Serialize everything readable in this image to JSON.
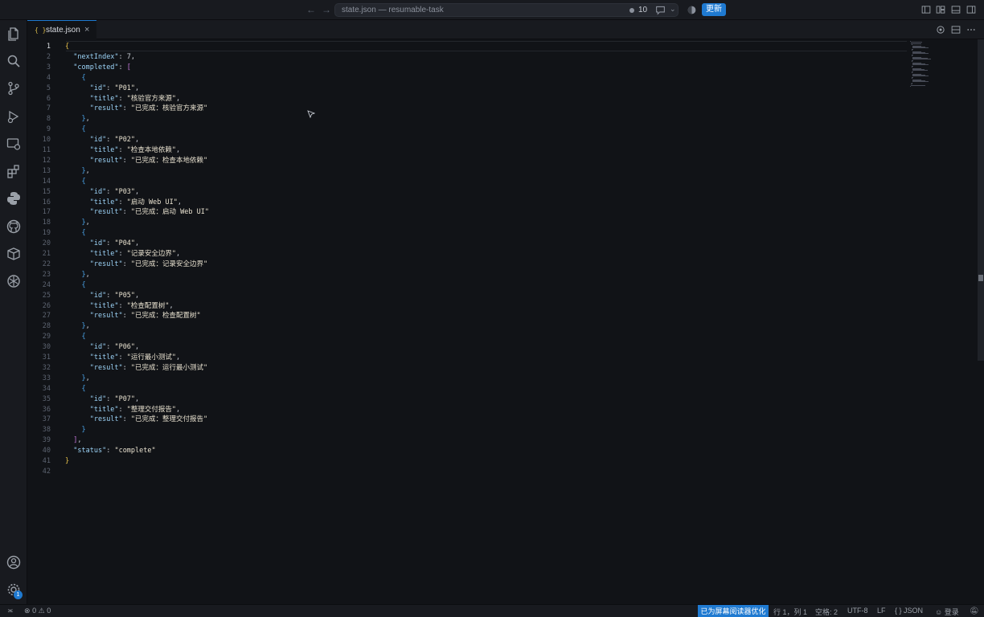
{
  "titlebar": {
    "back_icon": "arrow-left-icon",
    "forward_icon": "arrow-right-icon",
    "title": "state.json — resumable-task",
    "notification_count": "10",
    "update_label": "更新"
  },
  "tab": {
    "icon_glyph": "{ }",
    "label": "state.json",
    "close_glyph": "×"
  },
  "editor": {
    "active_line": 1,
    "lines": [
      "{",
      "  \"nextIndex\": 7,",
      "  \"completed\": [",
      "    {",
      "      \"id\": \"P01\",",
      "      \"title\": \"核验官方来源\",",
      "      \"result\": \"已完成：核验官方来源\"",
      "    },",
      "    {",
      "      \"id\": \"P02\",",
      "      \"title\": \"检查本地依赖\",",
      "      \"result\": \"已完成：检查本地依赖\"",
      "    },",
      "    {",
      "      \"id\": \"P03\",",
      "      \"title\": \"启动 Web UI\",",
      "      \"result\": \"已完成：启动 Web UI\"",
      "    },",
      "    {",
      "      \"id\": \"P04\",",
      "      \"title\": \"记录安全边界\",",
      "      \"result\": \"已完成：记录安全边界\"",
      "    },",
      "    {",
      "      \"id\": \"P05\",",
      "      \"title\": \"检查配置树\",",
      "      \"result\": \"已完成：检查配置树\"",
      "    },",
      "    {",
      "      \"id\": \"P06\",",
      "      \"title\": \"运行最小测试\",",
      "      \"result\": \"已完成：运行最小测试\"",
      "    },",
      "    {",
      "      \"id\": \"P07\",",
      "      \"title\": \"整理交付报告\",",
      "      \"result\": \"已完成：整理交付报告\"",
      "    }",
      "  ],",
      "  \"status\": \"complete\"",
      "}",
      ""
    ]
  },
  "activitybar": {
    "items": [
      "explorer-icon",
      "search-icon",
      "source-control-icon",
      "run-debug-icon",
      "remote-explorer-icon",
      "extensions-icon",
      "python-icon",
      "github-icon",
      "containers-icon",
      "openai-icon"
    ],
    "bottom": [
      "account-icon",
      "settings-icon"
    ],
    "settings_badge": "1"
  },
  "statusbar": {
    "remote_glyph": "≍",
    "errors": "0",
    "warnings": "0",
    "screen_reader": "已为屏幕阅读器优化",
    "position": "行 1，列 1",
    "spaces": "空格: 2",
    "encoding": "UTF-8",
    "eol": "LF",
    "language_glyph": "{ }",
    "language": "JSON",
    "login": "登录"
  }
}
